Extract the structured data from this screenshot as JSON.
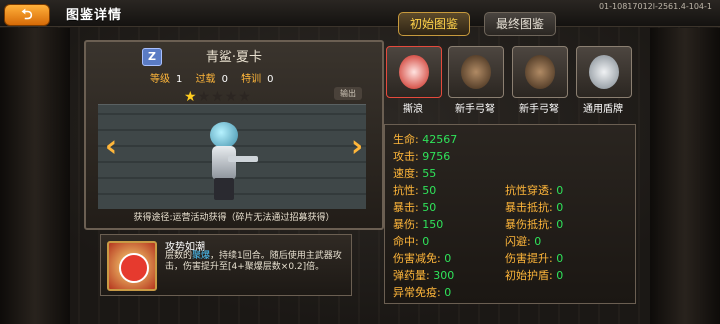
{
  "header": {
    "back_label": "⮌",
    "title": "图鉴详情",
    "tabs": [
      {
        "label": "初始图鉴",
        "active": true
      },
      {
        "label": "最终图鉴",
        "active": false
      }
    ],
    "version": "01-10817012l-2561.4-104-1"
  },
  "character": {
    "rank": "Z",
    "name": "青鲨·夏卡",
    "stats": [
      {
        "label": "等级",
        "value": "1"
      },
      {
        "label": "过载",
        "value": "0"
      },
      {
        "label": "特训",
        "value": "0"
      }
    ],
    "stars_filled": 1,
    "stars_total": 5,
    "export_label": "输出",
    "obtain_text": "获得途径:运营活动获得（碎片无法通过招募获得）"
  },
  "skill": {
    "name": "攻势如潮",
    "desc_part1": "层数的",
    "desc_highlight": "聚爆",
    "desc_part2": "，持续1回合。随后使用主武器攻击，伤害提升至[4+聚爆层数×0.2]倍。"
  },
  "equipment": [
    {
      "label": "撕浪",
      "icon": "red-gun-icon"
    },
    {
      "label": "新手弓弩",
      "icon": "crossbow-icon"
    },
    {
      "label": "新手弓弩",
      "icon": "crossbow-icon"
    },
    {
      "label": "通用盾牌",
      "icon": "shield-icon"
    }
  ],
  "attributes": {
    "left": [
      {
        "k": "生命:",
        "v": "42567"
      },
      {
        "k": "攻击:",
        "v": "9756"
      },
      {
        "k": "速度:",
        "v": "55"
      },
      {
        "k": "抗性:",
        "v": "50"
      },
      {
        "k": "暴击:",
        "v": "50"
      },
      {
        "k": "暴伤:",
        "v": "150"
      },
      {
        "k": "命中:",
        "v": "0"
      },
      {
        "k": "伤害减免:",
        "v": "0"
      },
      {
        "k": "弹药量:",
        "v": "300"
      },
      {
        "k": "异常免疫:",
        "v": "0"
      }
    ],
    "right": [
      {
        "k": "抗性穿透:",
        "v": "0"
      },
      {
        "k": "暴击抵抗:",
        "v": "0"
      },
      {
        "k": "暴伤抵抗:",
        "v": "0"
      },
      {
        "k": "闪避:",
        "v": "0"
      },
      {
        "k": "伤害提升:",
        "v": "0"
      },
      {
        "k": "初始护盾:",
        "v": "0"
      }
    ]
  },
  "colors": {
    "accent": "#ffb63a",
    "value_green": "#2fe35a",
    "highlight_blue": "#4bc7ff"
  }
}
